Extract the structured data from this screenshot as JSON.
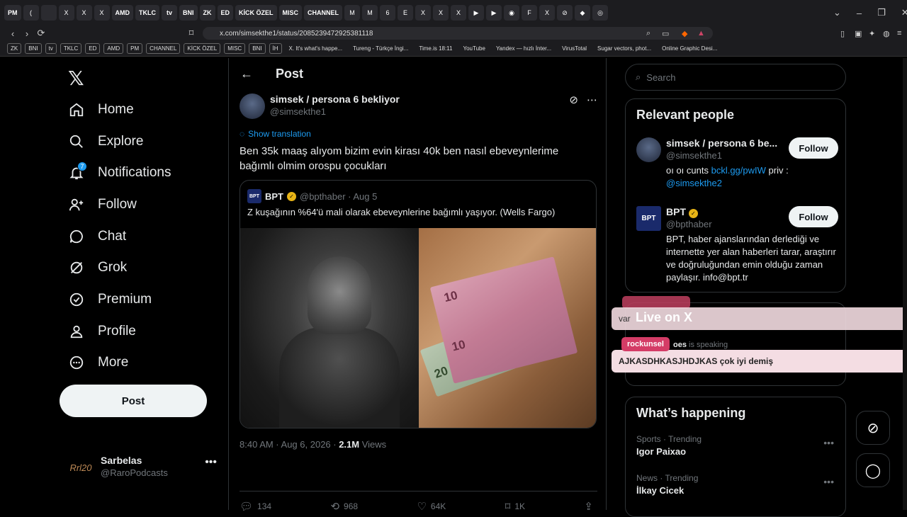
{
  "browser": {
    "tabs": [
      "PM",
      "(",
      "",
      "X",
      "X",
      "X",
      "AMD",
      "TKLC",
      "tv",
      "BNI",
      "ZK",
      "ED",
      "KİCK ÖZEL",
      "MISC",
      "CHANNEL",
      "M",
      "M",
      "6",
      "E",
      "X",
      "X",
      "X",
      "▶",
      "▶",
      "◉",
      "F",
      "X",
      "⊘",
      "◆",
      "◎"
    ],
    "url": "x.com/simsekthe1/status/2085239472925381118",
    "bookmarks": [
      "ZK",
      "BNI",
      "tv",
      "TKLC",
      "ED",
      "AMD",
      "PM",
      "CHANNEL",
      "KİCK ÖZEL",
      "MISC",
      "BNI",
      "İH"
    ],
    "bookmark_links": [
      "X. It's what's happe...",
      "Tureng - Türkçe İngi...",
      "Time.is 18:11",
      "YouTube",
      "Yandex — hızlı İnter...",
      "VirusTotal",
      "Sugar vectors, phot...",
      "Online Graphic Desi..."
    ]
  },
  "nav": {
    "items": [
      {
        "label": "Home"
      },
      {
        "label": "Explore"
      },
      {
        "label": "Notifications",
        "badge": "7"
      },
      {
        "label": "Follow"
      },
      {
        "label": "Chat"
      },
      {
        "label": "Grok"
      },
      {
        "label": "Premium"
      },
      {
        "label": "Profile"
      },
      {
        "label": "More"
      }
    ],
    "post_button": "Post",
    "account": {
      "name": "Sarbelas",
      "handle": "@RaroPodcasts",
      "avatar_text": "Rrl20"
    }
  },
  "post": {
    "header_title": "Post",
    "author_name": "simsek / persona 6 bekliyor",
    "author_handle": "@simsekthe1",
    "show_translation": "Show translation",
    "text": "Ben 35k maaş alıyom bizim evin kirası 40k ben nasıl ebeveynlerime bağımlı olmim orospu çocukları",
    "quote": {
      "avatar_text": "BPT",
      "name": "BPT",
      "handle_date": "@bpthaber · Aug 5",
      "text": "Z kuşağının %64'ü mali olarak ebeveynlerine bağımlı yaşıyor. (Wells Fargo)",
      "bill_labels": [
        "10",
        "10",
        "20"
      ]
    },
    "time": "8:40 AM · Aug 6, 2026 · ",
    "views_count": "2.1M",
    "views_label": " Views",
    "actions": {
      "replies": "134",
      "reposts": "968",
      "likes": "64K",
      "bookmarks": "1K"
    }
  },
  "sidebar": {
    "search_placeholder": "Search",
    "relevant_title": "Relevant people",
    "people": [
      {
        "name": "simsek / persona 6 be...",
        "handle": "@simsekthe1",
        "bio_pre": "oı oı cunts ",
        "bio_link": "bckl.gg/pwIW",
        "bio_mid": " priv : ",
        "bio_link2": "@simsekthe2",
        "follow": "Follow"
      },
      {
        "name": "BPT",
        "handle": "@bpthaber",
        "bio": "BPT, haber ajanslarından derlediği ve internette yer alan haberleri tarar, araştırır ve doğruluğundan emin olduğu zaman paylaşır. info@bpt.tr",
        "follow": "Follow",
        "avatar_text": "BPT"
      }
    ],
    "live_title": "Live on X",
    "speaking_name": "oes",
    "speaking_suffix": " is speaking",
    "whats_happening": "What’s happening",
    "trends": [
      {
        "category": "Sports · Trending",
        "name": "Igor Paixao"
      },
      {
        "category": "News · Trending",
        "name": "İlkay Cicek"
      }
    ]
  },
  "overlay": {
    "chat1_text": "var",
    "chat2_user": "rockunsel",
    "chat2_text": "AJKASDHKASJHDJKAS çok iyi demiş"
  }
}
